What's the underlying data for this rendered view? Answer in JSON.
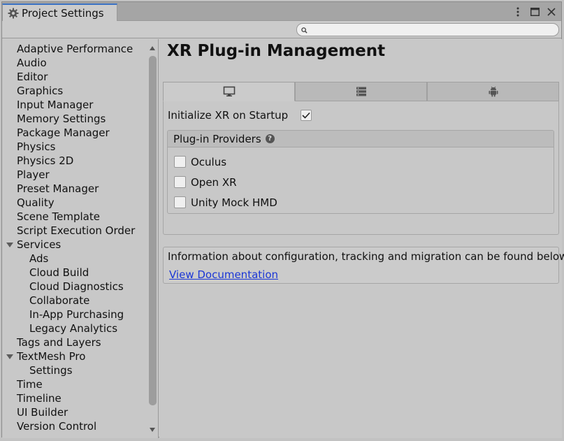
{
  "window": {
    "tab_title": "Project Settings"
  },
  "search": {
    "placeholder": "",
    "value": ""
  },
  "sidebar": {
    "items": [
      {
        "label": "Adaptive Performance",
        "level": 0
      },
      {
        "label": "Audio",
        "level": 0
      },
      {
        "label": "Editor",
        "level": 0
      },
      {
        "label": "Graphics",
        "level": 0
      },
      {
        "label": "Input Manager",
        "level": 0
      },
      {
        "label": "Memory Settings",
        "level": 0
      },
      {
        "label": "Package Manager",
        "level": 0
      },
      {
        "label": "Physics",
        "level": 0
      },
      {
        "label": "Physics 2D",
        "level": 0
      },
      {
        "label": "Player",
        "level": 0
      },
      {
        "label": "Preset Manager",
        "level": 0
      },
      {
        "label": "Quality",
        "level": 0
      },
      {
        "label": "Scene Template",
        "level": 0
      },
      {
        "label": "Script Execution Order",
        "level": 0
      },
      {
        "label": "Services",
        "level": 0,
        "expanded": true
      },
      {
        "label": "Ads",
        "level": 1
      },
      {
        "label": "Cloud Build",
        "level": 1
      },
      {
        "label": "Cloud Diagnostics",
        "level": 1
      },
      {
        "label": "Collaborate",
        "level": 1
      },
      {
        "label": "In-App Purchasing",
        "level": 1
      },
      {
        "label": "Legacy Analytics",
        "level": 1
      },
      {
        "label": "Tags and Layers",
        "level": 0
      },
      {
        "label": "TextMesh Pro",
        "level": 0,
        "expanded": true
      },
      {
        "label": "Settings",
        "level": 1
      },
      {
        "label": "Time",
        "level": 0
      },
      {
        "label": "Timeline",
        "level": 0
      },
      {
        "label": "UI Builder",
        "level": 0
      },
      {
        "label": "Version Control",
        "level": 0
      }
    ]
  },
  "main": {
    "title": "XR Plug-in Management",
    "platform_tabs": [
      {
        "icon": "desktop-monitor-icon",
        "active": true
      },
      {
        "icon": "server-stack-icon",
        "active": false
      },
      {
        "icon": "android-icon",
        "active": false
      }
    ],
    "init_label": "Initialize XR on Startup",
    "init_checked": true,
    "providers": {
      "header": "Plug-in Providers",
      "items": [
        {
          "label": "Oculus",
          "checked": false
        },
        {
          "label": "Open XR",
          "checked": false
        },
        {
          "label": "Unity Mock HMD",
          "checked": false
        }
      ]
    },
    "info": {
      "text": "Information about configuration, tracking and migration can be found below.",
      "link": "View Documentation"
    }
  },
  "colors": {
    "accent_tab": "#3a72c4",
    "link": "#1a36d6",
    "window_bg": "#c8c8c8"
  }
}
